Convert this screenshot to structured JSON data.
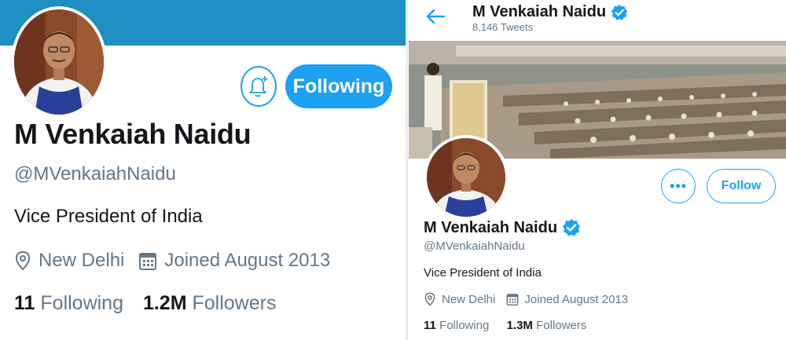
{
  "left": {
    "name": "M Venkaiah Naidu",
    "handle": "@MVenkaiahNaidu",
    "bio": "Vice President of India",
    "location": "New Delhi",
    "joined": "Joined August 2013",
    "following_count": "11",
    "following_label": "Following",
    "followers_count": "1.2M",
    "followers_label": "Followers",
    "follow_button_label": "Following"
  },
  "right": {
    "header_name": "M Venkaiah Naidu",
    "tweet_count": "8,146 Tweets",
    "name": "M Venkaiah Naidu",
    "handle": "@MVenkaiahNaidu",
    "bio": "Vice President of India",
    "location": "New Delhi",
    "joined": "Joined August 2013",
    "following_count": "11",
    "following_label": "Following",
    "followers_count": "1.3M",
    "followers_label": "Followers",
    "follow_button_label": "Follow",
    "more_button_label": "•••"
  },
  "icons": {
    "notify": "bell-plus-icon",
    "back": "back-arrow-icon",
    "verified": "verified-badge-icon",
    "location": "location-pin-icon",
    "calendar": "calendar-icon"
  },
  "colors": {
    "accent": "#1da1f2",
    "banner_left": "#1d8fc1",
    "text_primary": "#14171a",
    "text_secondary": "#657786"
  }
}
